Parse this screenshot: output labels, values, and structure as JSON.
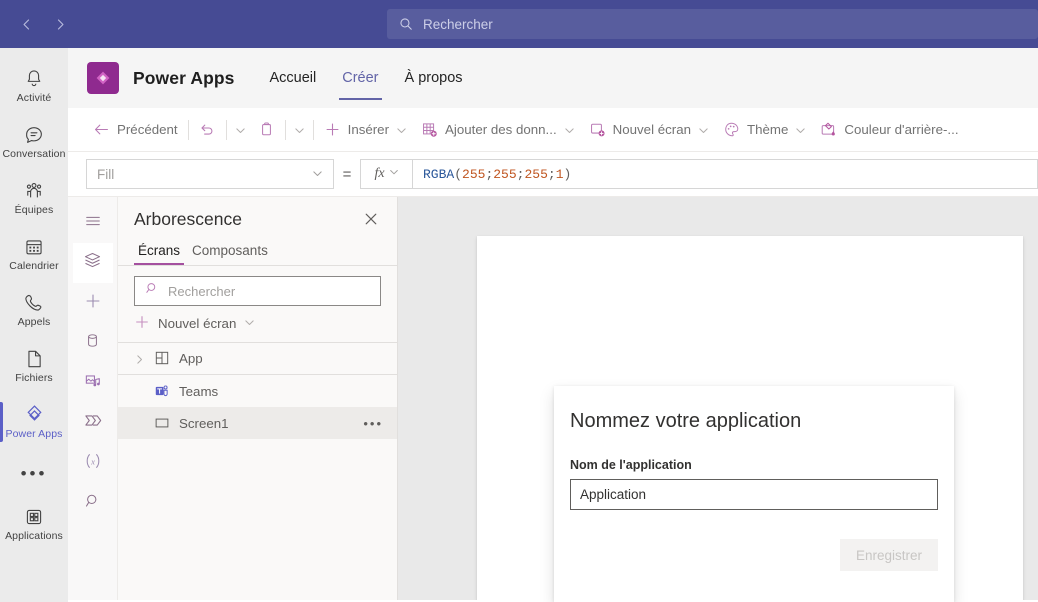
{
  "teams": {
    "nav": {
      "back": "‹",
      "forward": "›"
    },
    "search": {
      "placeholder": "Rechercher",
      "icon": "search-icon"
    },
    "rail": [
      {
        "label": "Activité",
        "icon": "bell-icon",
        "active": false
      },
      {
        "label": "Conversation",
        "icon": "chat-icon",
        "active": false
      },
      {
        "label": "Équipes",
        "icon": "teams-people-icon",
        "active": false
      },
      {
        "label": "Calendrier",
        "icon": "calendar-icon",
        "active": false
      },
      {
        "label": "Appels",
        "icon": "phone-icon",
        "active": false
      },
      {
        "label": "Fichiers",
        "icon": "file-icon",
        "active": false
      },
      {
        "label": "Power Apps",
        "icon": "power-apps-icon",
        "active": true
      },
      {
        "label": "Applications",
        "icon": "apps-grid-icon",
        "active": false
      }
    ],
    "more_label": "•••"
  },
  "app_header": {
    "logo": "power-apps-logo",
    "title": "Power Apps",
    "tabs": [
      {
        "label": "Accueil",
        "active": false
      },
      {
        "label": "Créer",
        "active": true
      },
      {
        "label": "À propos",
        "active": false
      }
    ],
    "accent": "#6264a7"
  },
  "commandbar": {
    "back": {
      "label": "Précédent",
      "icon": "arrow-left-icon"
    },
    "undo": {
      "icon": "undo-icon"
    },
    "paste": {
      "icon": "clipboard-icon"
    },
    "insert": {
      "label": "Insérer",
      "icon": "plus-icon"
    },
    "add_data": {
      "label": "Ajouter des donn...",
      "icon": "add-data-icon"
    },
    "new_screen": {
      "label": "Nouvel écran",
      "icon": "new-screen-icon"
    },
    "theme": {
      "label": "Thème",
      "icon": "palette-icon"
    },
    "background_color": {
      "label": "Couleur d'arrière-...",
      "icon": "background-color-icon"
    },
    "caret": "chevron-down-icon"
  },
  "formula_bar": {
    "property": "Fill",
    "equals": "=",
    "fx_label": "fx",
    "formula_fn": "RGBA",
    "formula_open": "(",
    "formula_args": [
      "255",
      "255",
      "255",
      "1"
    ],
    "formula_sep": "; ",
    "formula_close": ")",
    "formula_full": "RGBA(255; 255; 255; 1)"
  },
  "icon_rail": [
    {
      "icon": "hamburger-menu-icon",
      "active": false
    },
    {
      "icon": "tree-view-layers-icon",
      "active": true
    },
    {
      "icon": "insert-plus-icon",
      "active": false
    },
    {
      "icon": "data-source-icon",
      "active": false
    },
    {
      "icon": "media-icon",
      "active": false
    },
    {
      "icon": "power-automate-icon",
      "active": false
    },
    {
      "icon": "variables-icon",
      "active": false
    },
    {
      "icon": "search-icon",
      "active": false
    }
  ],
  "tree_panel": {
    "title": "Arborescence",
    "close_icon": "close-icon",
    "tabs": [
      {
        "label": "Écrans",
        "active": true
      },
      {
        "label": "Composants",
        "active": false
      }
    ],
    "search_placeholder": "Rechercher",
    "new_screen_label": "Nouvel écran",
    "items": [
      {
        "label": "App",
        "icon": "app-icon",
        "expandable": true,
        "selected": false,
        "overflow": false
      },
      {
        "label": "Teams",
        "icon": "teams-icon",
        "expandable": false,
        "selected": false,
        "overflow": false
      },
      {
        "label": "Screen1",
        "icon": "screen-icon",
        "expandable": false,
        "selected": true,
        "overflow": true,
        "overflow_label": "•••"
      }
    ]
  },
  "modal": {
    "title": "Nommez votre application",
    "field_label": "Nom de l'application",
    "field_value": "Application",
    "save_label": "Enregistrer",
    "save_disabled": true
  }
}
